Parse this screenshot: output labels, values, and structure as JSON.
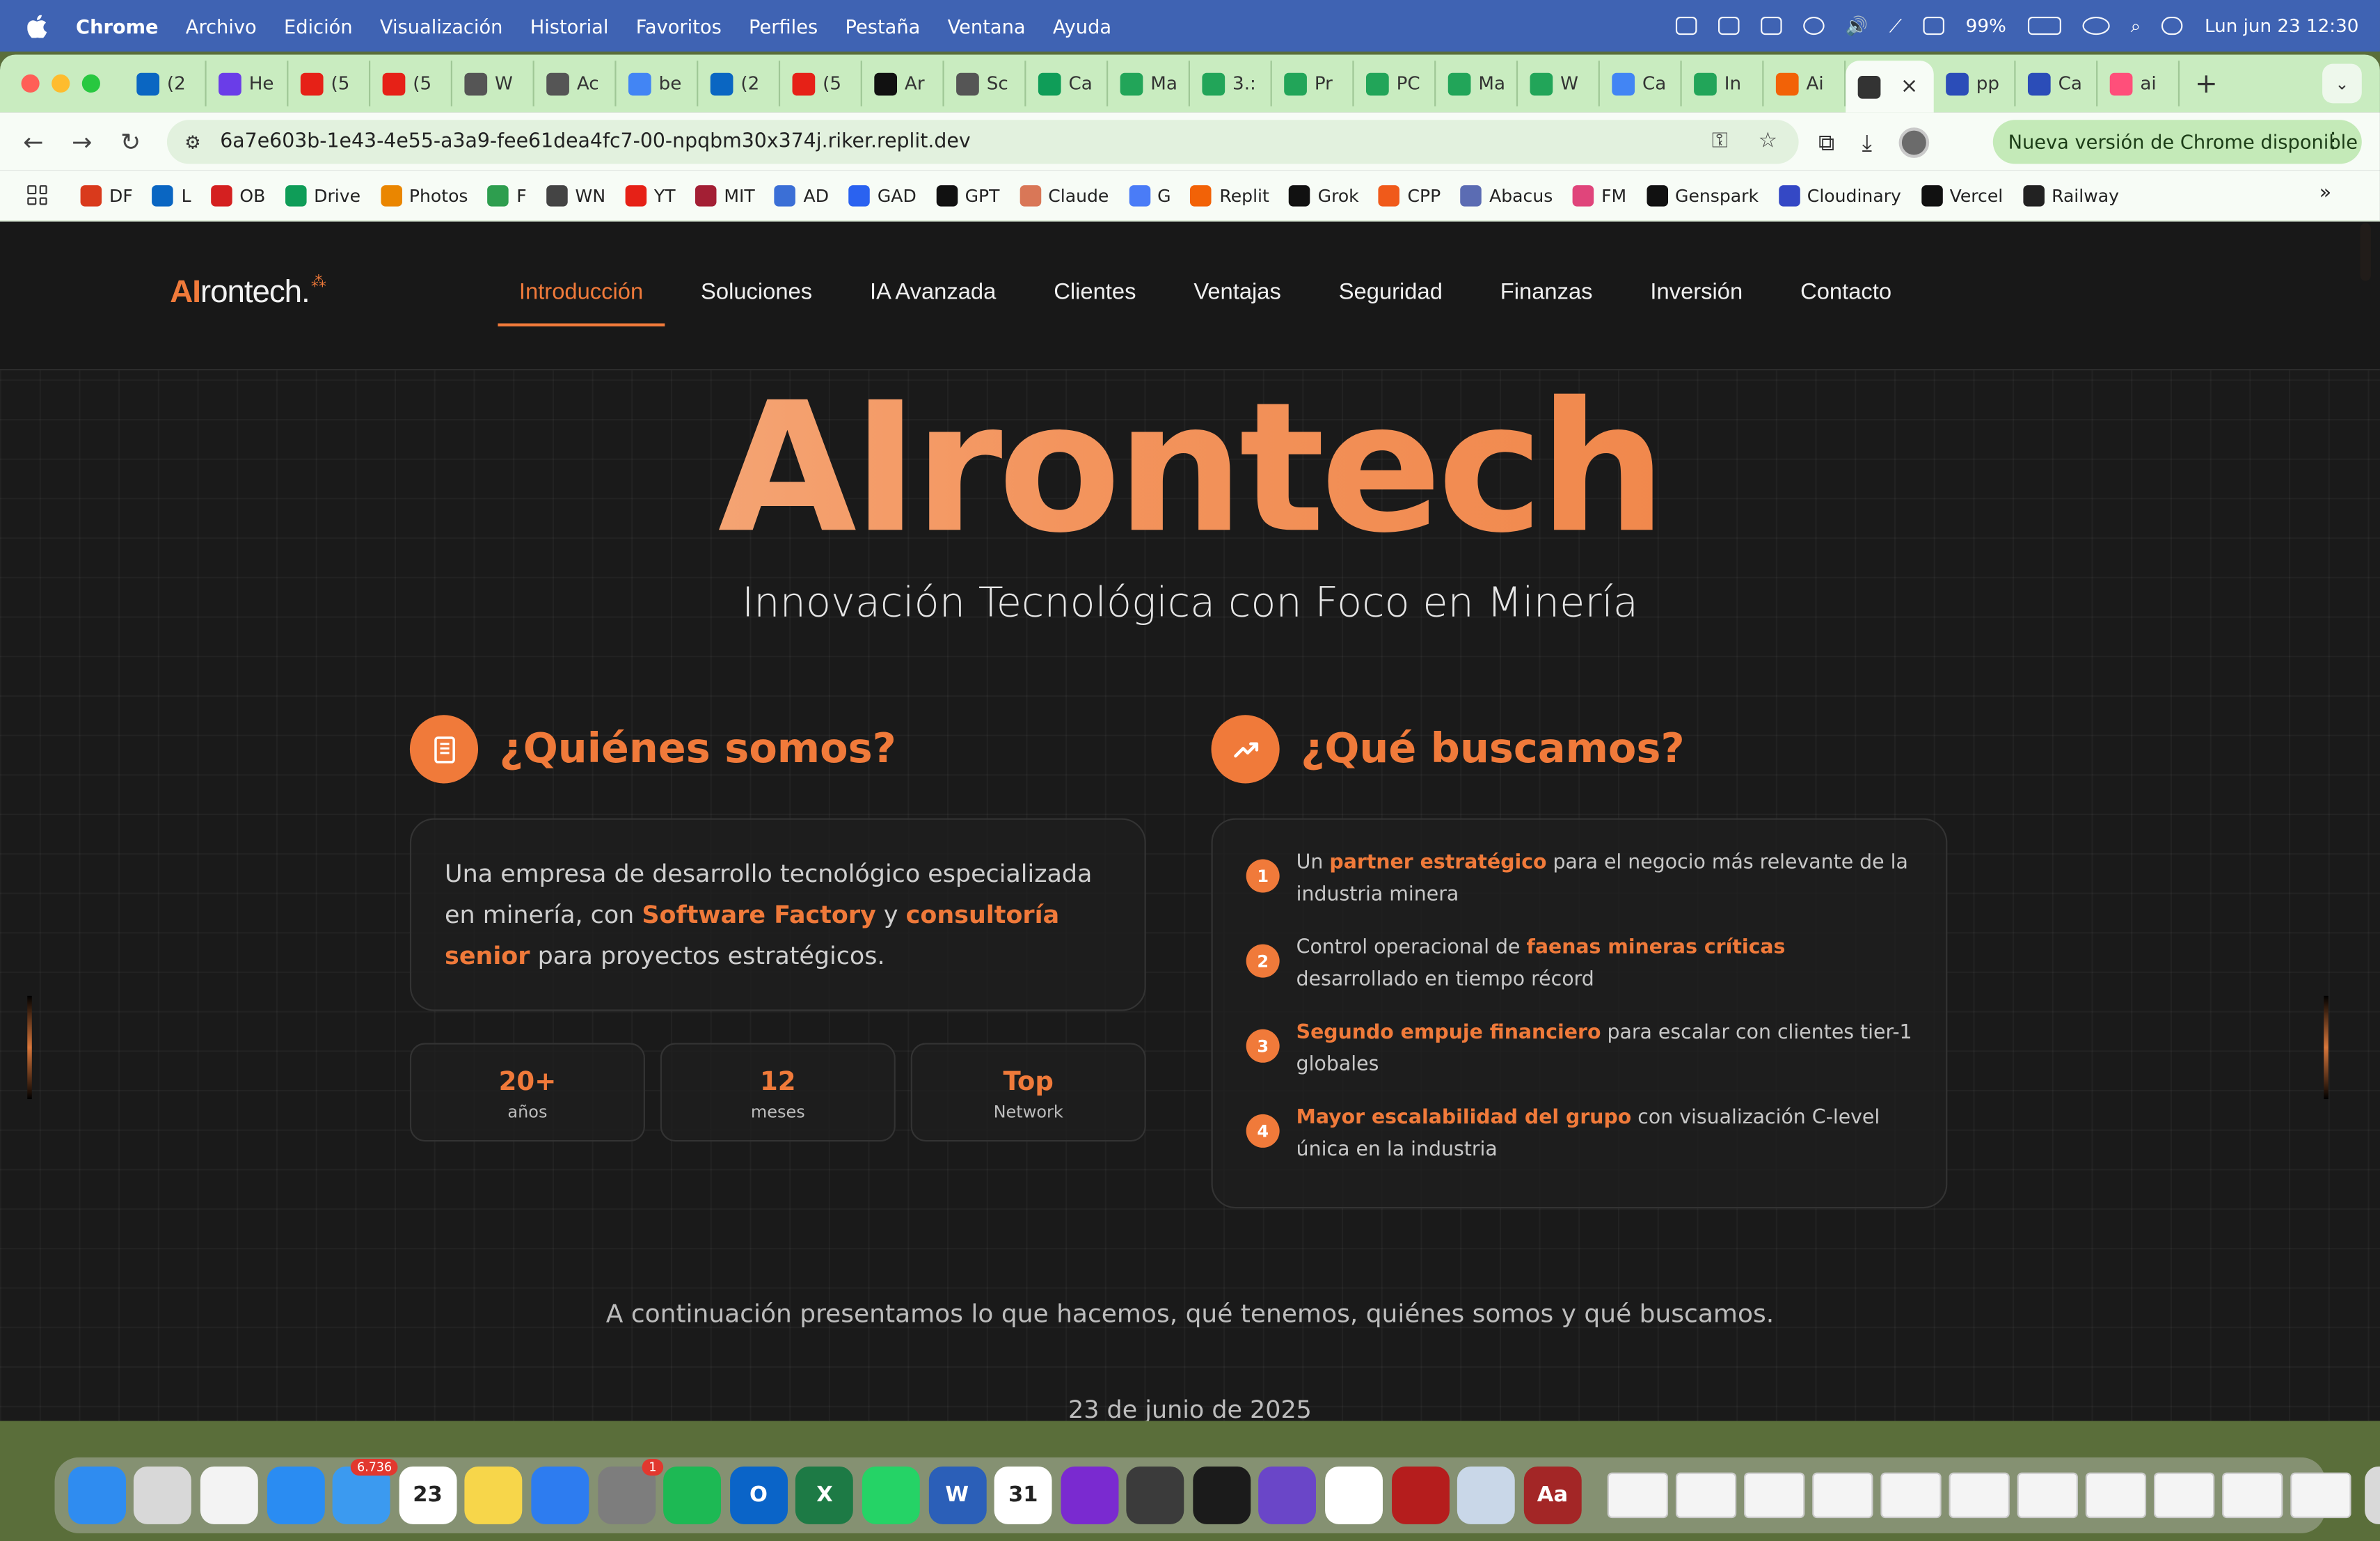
{
  "menubar": {
    "items": [
      "Chrome",
      "Archivo",
      "Edición",
      "Visualización",
      "Historial",
      "Favoritos",
      "Perfiles",
      "Pestaña",
      "Ventana",
      "Ayuda"
    ],
    "battery": "99%",
    "datetime": "Lun jun 23  12:30"
  },
  "tabs": [
    "(2",
    "He",
    "(5",
    "(5",
    "W",
    "Ac",
    "be",
    "(2",
    "(5",
    "Ar",
    "Sc",
    "Ca",
    "Ma",
    "3.:",
    "Pr",
    "PC",
    "Ma",
    "W",
    "Ca",
    "In",
    "Ai",
    "",
    "pp",
    "Ca",
    "ai"
  ],
  "tab_colors": [
    "#0a66c2",
    "#6a3de8",
    "#e62117",
    "#e62117",
    "#555555",
    "#555555",
    "#4285f4",
    "#0a66c2",
    "#e62117",
    "#111111",
    "#555555",
    "#0f9d58",
    "#22a559",
    "#22a559",
    "#22a559",
    "#22a559",
    "#22a559",
    "#22a559",
    "#4285f4",
    "#22a559",
    "#f26207",
    "#333333",
    "#2b4db8",
    "#2b4db8",
    "#ff4f7a"
  ],
  "address": {
    "url": "6a7e603b-1e43-4e55-a3a9-fee61dea4fc7-00-npqbm30x374j.riker.replit.dev",
    "update_label": "Nueva versión de Chrome disponible"
  },
  "bookmarks": [
    {
      "label": "DF",
      "color": "#d93a1c"
    },
    {
      "label": "L",
      "color": "#0a66c2"
    },
    {
      "label": "OB",
      "color": "#d42020"
    },
    {
      "label": "Drive",
      "color": "#0f9d58"
    },
    {
      "label": "Photos",
      "color": "#ea8600"
    },
    {
      "label": "F",
      "color": "#2e9e4f"
    },
    {
      "label": "WN",
      "color": "#444444"
    },
    {
      "label": "YT",
      "color": "#e62117"
    },
    {
      "label": "MIT",
      "color": "#a31f34"
    },
    {
      "label": "AD",
      "color": "#3b6fd6"
    },
    {
      "label": "GAD",
      "color": "#2a62f0"
    },
    {
      "label": "GPT",
      "color": "#111111"
    },
    {
      "label": "Claude",
      "color": "#d97757"
    },
    {
      "label": "G",
      "color": "#4a7cf7"
    },
    {
      "label": "Replit",
      "color": "#f26207"
    },
    {
      "label": "Grok",
      "color": "#111111"
    },
    {
      "label": "CPP",
      "color": "#f05a1a"
    },
    {
      "label": "Abacus",
      "color": "#5b6cb3"
    },
    {
      "label": "FM",
      "color": "#e0457b"
    },
    {
      "label": "Genspark",
      "color": "#111111"
    },
    {
      "label": "Cloudinary",
      "color": "#3448c5"
    },
    {
      "label": "Vercel",
      "color": "#111111"
    },
    {
      "label": "Railway",
      "color": "#222222"
    }
  ],
  "site": {
    "logo_ai": "AI",
    "logo_rest": "rontech.",
    "nav": [
      "Introducción",
      "Soluciones",
      "IA Avanzada",
      "Clientes",
      "Ventajas",
      "Seguridad",
      "Finanzas",
      "Inversión",
      "Contacto"
    ],
    "hero_title": "AIrontech",
    "hero_subtitle": "Innovación Tecnológica con Foco en Minería",
    "who": {
      "title": "¿Quiénes somos?",
      "text_1": "Una empresa de desarrollo tecnológico especializada en minería, con ",
      "hl_1": "Software Factory",
      "text_2": " y ",
      "hl_2": "consultoría senior",
      "text_3": " para proyectos estratégicos."
    },
    "stats": [
      {
        "value": "20+",
        "label": "años"
      },
      {
        "value": "12",
        "label": "meses"
      },
      {
        "value": "Top",
        "label": "Network"
      }
    ],
    "seek": {
      "title": "¿Qué buscamos?",
      "items": [
        {
          "n": "1",
          "pre": "Un ",
          "hl": "partner estratégico",
          "post": " para el negocio más relevante de la industria minera"
        },
        {
          "n": "2",
          "pre": "Control operacional de ",
          "hl": "faenas mineras críticas",
          "post": " desarrollado en tiempo récord"
        },
        {
          "n": "3",
          "pre": "",
          "hl": "Segundo empuje financiero",
          "post": " para escalar con clientes tier-1 globales"
        },
        {
          "n": "4",
          "pre": "",
          "hl": "Mayor escalabilidad del grupo",
          "post": " con visualización C-level única en la industria"
        }
      ]
    },
    "continuation": "A continuación presentamos lo que hacemos, qué tenemos, quiénes somos y qué buscamos.",
    "date": "23 de junio de 2025"
  },
  "dock": {
    "apps": [
      {
        "name": "finder",
        "color": "#2f8cf0",
        "glyph": ""
      },
      {
        "name": "launchpad",
        "color": "#d8d8d8",
        "glyph": ""
      },
      {
        "name": "chrome",
        "color": "#f3f3f3",
        "glyph": ""
      },
      {
        "name": "safari",
        "color": "#2a8cf2",
        "glyph": ""
      },
      {
        "name": "mail",
        "color": "#3b9af0",
        "glyph": "",
        "badge": "6.736"
      },
      {
        "name": "calendar",
        "color": "#ffffff",
        "glyph": "23"
      },
      {
        "name": "notes",
        "color": "#f7d64a",
        "glyph": ""
      },
      {
        "name": "keynote",
        "color": "#2d7cf0",
        "glyph": ""
      },
      {
        "name": "system-settings",
        "color": "#7d7d7d",
        "glyph": "",
        "badge": "1"
      },
      {
        "name": "spotify",
        "color": "#1db954",
        "glyph": ""
      },
      {
        "name": "outlook",
        "color": "#0a64c8",
        "glyph": "O"
      },
      {
        "name": "excel",
        "color": "#1d7a45",
        "glyph": "X"
      },
      {
        "name": "whatsapp",
        "color": "#25d366",
        "glyph": ""
      },
      {
        "name": "word",
        "color": "#2b5fb8",
        "glyph": "W"
      },
      {
        "name": "fantastical",
        "color": "#ffffff",
        "glyph": "31"
      },
      {
        "name": "screen-recorder",
        "color": "#7a2ad0",
        "glyph": ""
      },
      {
        "name": "iphone-mirroring",
        "color": "#3b3b3b",
        "glyph": ""
      },
      {
        "name": "replit",
        "color": "#1b1b1b",
        "glyph": ""
      },
      {
        "name": "github",
        "color": "#6a46c8",
        "glyph": ""
      },
      {
        "name": "vscode",
        "color": "#ffffff",
        "glyph": ""
      },
      {
        "name": "acrobat",
        "color": "#b51d1d",
        "glyph": ""
      },
      {
        "name": "preview",
        "color": "#c9d7e8",
        "glyph": ""
      },
      {
        "name": "dictionary",
        "color": "#a32626",
        "glyph": "Aa"
      }
    ]
  }
}
